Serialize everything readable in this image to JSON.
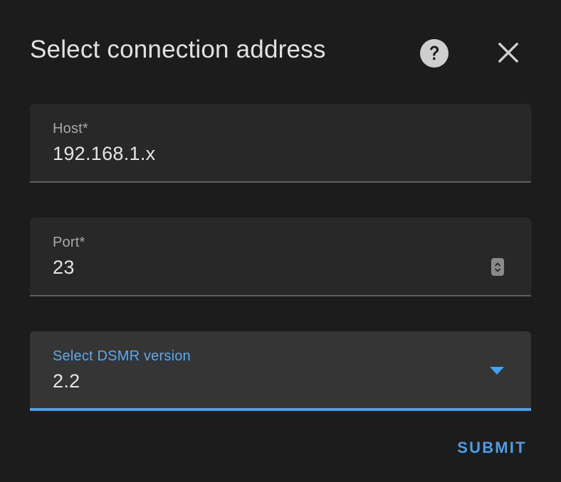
{
  "dialog": {
    "title": "Select connection address",
    "help_icon": "help-circle-icon",
    "close_icon": "close-icon"
  },
  "fields": {
    "host": {
      "label": "Host*",
      "value": "192.168.1.x"
    },
    "port": {
      "label": "Port*",
      "value": "23",
      "stepper_icon": "number-stepper-icon"
    },
    "dsmr_version": {
      "label": "Select DSMR version",
      "selected": "2.2",
      "dropdown_icon": "caret-down-icon"
    }
  },
  "actions": {
    "submit_label": "SUBMIT"
  },
  "colors": {
    "background": "#1c1c1c",
    "field_background": "#282828",
    "selected_field_background": "#353535",
    "accent": "#4a9eea",
    "text": "#e1e1e1"
  }
}
